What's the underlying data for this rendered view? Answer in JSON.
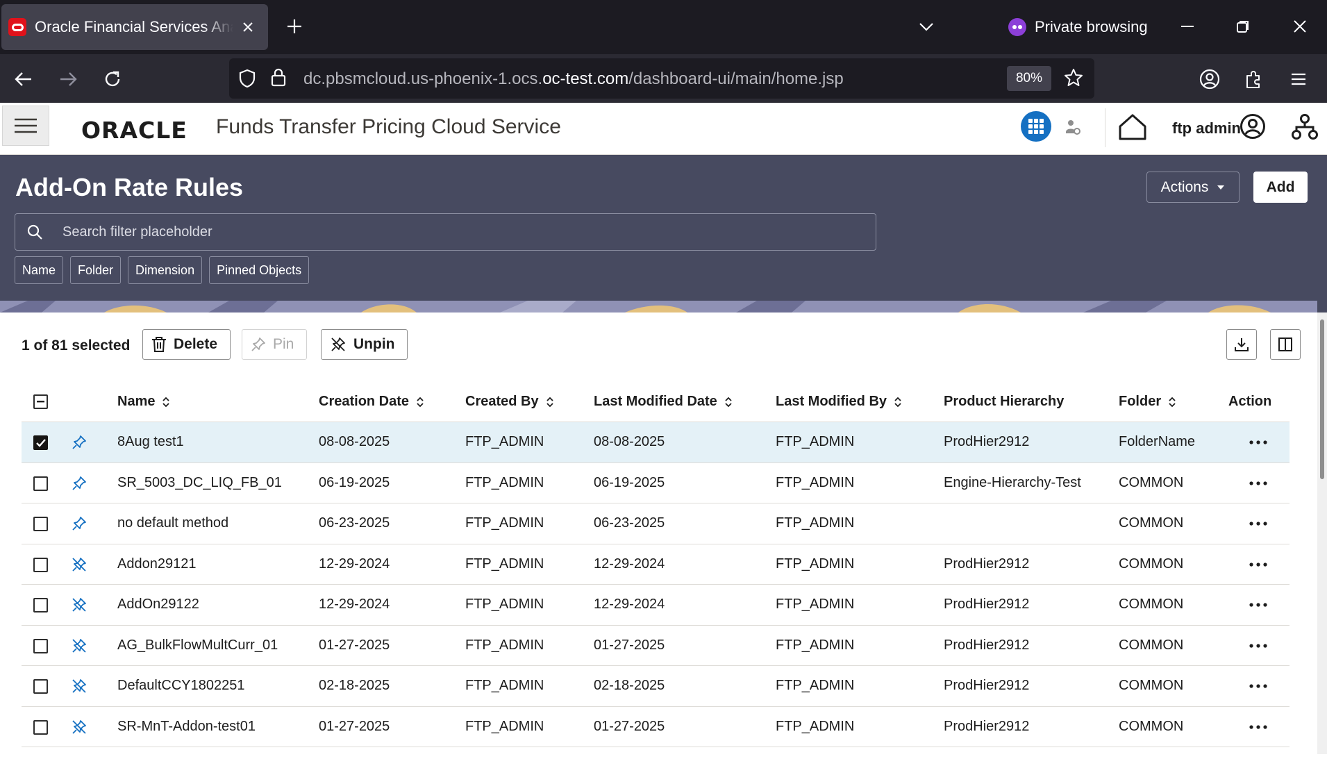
{
  "browser": {
    "tab_title": "Oracle Financial Services Analytical Applications",
    "private_label": "Private browsing",
    "url_prefix": "dc.pbsmcloud.us-phoenix-1.ocs.",
    "url_domain": "oc-test.com",
    "url_path": "/dashboard-ui/main/home.jsp",
    "zoom": "80%"
  },
  "app": {
    "logo": "ORACLE",
    "title": "Funds Transfer Pricing Cloud Service",
    "user_name": "ftp admin",
    "accent_color": "#1570c2"
  },
  "page": {
    "title": "Add-On Rate Rules",
    "actions_label": "Actions",
    "add_label": "Add",
    "search_placeholder": "Search filter placeholder",
    "filter_chips": [
      "Name",
      "Folder",
      "Dimension",
      "Pinned Objects"
    ]
  },
  "toolbar": {
    "selection": "1 of 81 selected",
    "delete_label": "Delete",
    "pin_label": "Pin",
    "unpin_label": "Unpin"
  },
  "table": {
    "columns": [
      "Name",
      "Creation Date",
      "Created By",
      "Last Modified Date",
      "Last Modified By",
      "Product Hierarchy",
      "Folder",
      "Action"
    ],
    "rows": [
      {
        "selected": true,
        "pinned": true,
        "name": "8Aug test1",
        "creation_date": "08-08-2025",
        "created_by": "FTP_ADMIN",
        "modified_date": "08-08-2025",
        "modified_by": "FTP_ADMIN",
        "hierarchy": "ProdHier2912",
        "folder": "FolderName"
      },
      {
        "selected": false,
        "pinned": true,
        "name": "SR_5003_DC_LIQ_FB_01",
        "creation_date": "06-19-2025",
        "created_by": "FTP_ADMIN",
        "modified_date": "06-19-2025",
        "modified_by": "FTP_ADMIN",
        "hierarchy": "Engine-Hierarchy-Test",
        "folder": "COMMON"
      },
      {
        "selected": false,
        "pinned": true,
        "name": "no default method",
        "creation_date": "06-23-2025",
        "created_by": "FTP_ADMIN",
        "modified_date": "06-23-2025",
        "modified_by": "FTP_ADMIN",
        "hierarchy": "",
        "folder": "COMMON"
      },
      {
        "selected": false,
        "pinned": false,
        "name": "Addon29121",
        "creation_date": "12-29-2024",
        "created_by": "FTP_ADMIN",
        "modified_date": "12-29-2024",
        "modified_by": "FTP_ADMIN",
        "hierarchy": "ProdHier2912",
        "folder": "COMMON"
      },
      {
        "selected": false,
        "pinned": false,
        "name": "AddOn29122",
        "creation_date": "12-29-2024",
        "created_by": "FTP_ADMIN",
        "modified_date": "12-29-2024",
        "modified_by": "FTP_ADMIN",
        "hierarchy": "ProdHier2912",
        "folder": "COMMON"
      },
      {
        "selected": false,
        "pinned": false,
        "name": "AG_BulkFlowMultCurr_01",
        "creation_date": "01-27-2025",
        "created_by": "FTP_ADMIN",
        "modified_date": "01-27-2025",
        "modified_by": "FTP_ADMIN",
        "hierarchy": "ProdHier2912",
        "folder": "COMMON"
      },
      {
        "selected": false,
        "pinned": false,
        "name": "DefaultCCY1802251",
        "creation_date": "02-18-2025",
        "created_by": "FTP_ADMIN",
        "modified_date": "02-18-2025",
        "modified_by": "FTP_ADMIN",
        "hierarchy": "ProdHier2912",
        "folder": "COMMON"
      },
      {
        "selected": false,
        "pinned": false,
        "name": "SR-MnT-Addon-test01",
        "creation_date": "01-27-2025",
        "created_by": "FTP_ADMIN",
        "modified_date": "01-27-2025",
        "modified_by": "FTP_ADMIN",
        "hierarchy": "ProdHier2912",
        "folder": "COMMON"
      }
    ]
  }
}
